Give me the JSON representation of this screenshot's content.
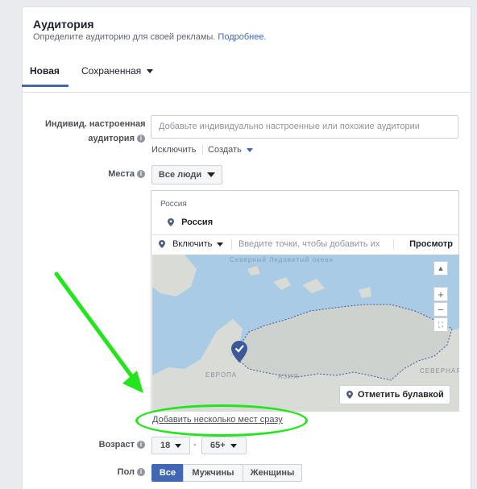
{
  "header": {
    "title": "Аудитория",
    "subtitle": "Определите аудиторию для своей рекламы.",
    "learn_more": "Подробнее."
  },
  "tabs": [
    {
      "label": "Новая",
      "active": true
    },
    {
      "label": "Сохраненная",
      "active": false
    }
  ],
  "custom_audience": {
    "label_line1": "Индивид. настроенная",
    "label_line2": "аудитория",
    "placeholder": "Добавьте индивидуально настроенные или похожие аудитории",
    "exclude": "Исключить",
    "create": "Создать"
  },
  "locations": {
    "label": "Места",
    "scope": "Все люди",
    "country": "Россия",
    "selected": "Россия",
    "include": "Включить",
    "search_placeholder": "Введите точки, чтобы добавить их",
    "preview": "Просмотр",
    "map": {
      "label_ocean": "Северный Ледовитый океан",
      "label_europe": "ЕВРОПА",
      "label_asia": "АЗИЯ",
      "label_north": "СЕВЕРНАЯ",
      "zoom_in": "+",
      "zoom_out": "−",
      "drop_pin": "Отметить булавкой"
    },
    "bulk_add": "Добавить несколько мест сразу"
  },
  "age": {
    "label": "Возраст",
    "min": "18",
    "separator": "-",
    "max": "65+"
  },
  "gender": {
    "label": "Пол",
    "options": [
      "Все",
      "Мужчины",
      "Женщины"
    ],
    "selected": "Все"
  },
  "colors": {
    "accent": "#4267b2",
    "highlight_green": "#22e51b",
    "map_water": "#a9cbe6",
    "map_land": "#d9dcd6"
  }
}
